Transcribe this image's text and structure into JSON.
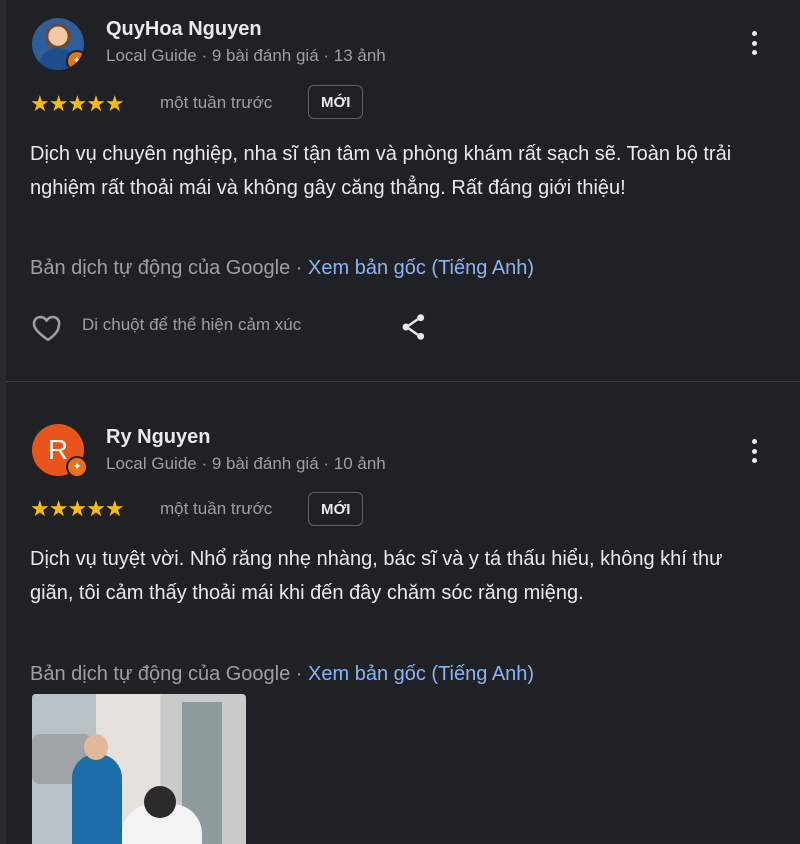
{
  "reviews": [
    {
      "name": "QuyHoa Nguyen",
      "meta": "Local Guide · 9 bài đánh giá · 13 ảnh",
      "stars": "★★★★★",
      "time": "một tuần trước",
      "tag": "MỚI",
      "text": "Dịch vụ chuyên nghiệp, nha sĩ tận tâm và phòng khám rất sạch sẽ. Toàn bộ trải nghiệm rất thoải mái và không gây căng thẳng. Rất đáng giới thiệu!",
      "translation_prefix": "Bản dịch tự động của Google · ",
      "translation_link": "Xem bản gốc (Tiếng Anh)",
      "react_label": "Di chuột để thể hiện cảm xúc"
    },
    {
      "name": "Ry Nguyen",
      "avatar_letter": "R",
      "meta": "Local Guide · 9 bài đánh giá · 10 ảnh",
      "stars": "★★★★★",
      "time": "một tuần trước",
      "tag": "MỚI",
      "text": "Dịch vụ tuyệt vời. Nhổ răng nhẹ nhàng, bác sĩ và y tá thấu hiểu, không khí thư giãn, tôi cảm thấy thoải mái khi đến đây chăm sóc răng miệng.",
      "translation_prefix": "Bản dịch tự động của Google · ",
      "translation_link": "Xem bản gốc (Tiếng Anh)"
    }
  ],
  "icons": {
    "more": "more-vert-icon",
    "heart": "heart-outline-icon",
    "share": "share-icon",
    "badge": "local-guide-badge-icon"
  },
  "colors": {
    "background": "#202124",
    "star": "#fbbc04",
    "link": "#8ab4f8",
    "avatar_r": "#e8541a"
  },
  "rating": {
    "review1": 5,
    "review2": 5
  }
}
